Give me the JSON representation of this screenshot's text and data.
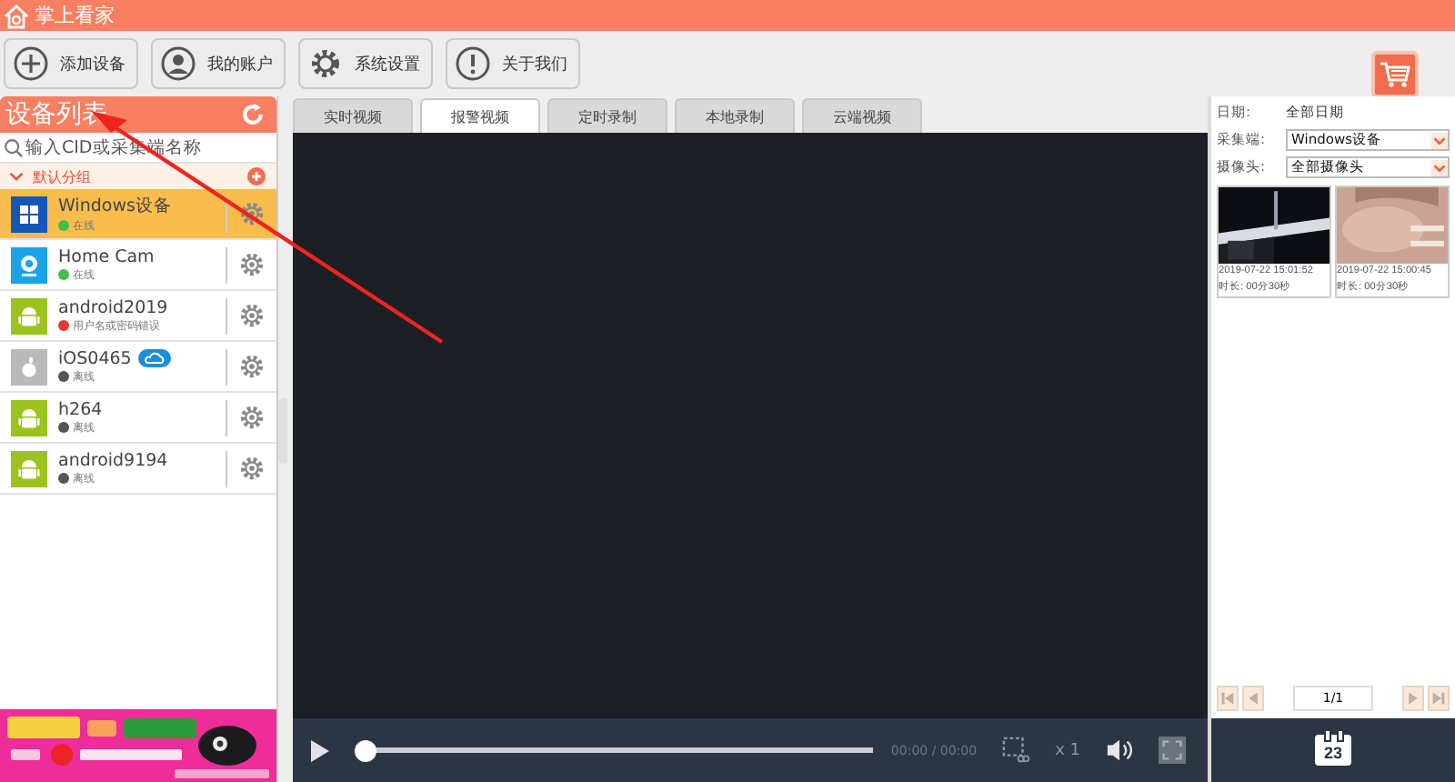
{
  "window": {
    "title": "掌上看家"
  },
  "toolbar": [
    {
      "label": "添加设备",
      "kind": "plus"
    },
    {
      "label": "我的账户",
      "kind": "user"
    },
    {
      "label": "系统设置",
      "kind": "gear"
    },
    {
      "label": "关于我们",
      "kind": "info"
    }
  ],
  "sidebar": {
    "title": "设备列表",
    "search": {
      "placeholder": "输入CID或采集端名称"
    },
    "group": {
      "label": "默认分组",
      "expanded": true
    },
    "devices": [
      {
        "name": "Windows设备",
        "kind": "windows",
        "status": "在线",
        "color": "#3cc04a",
        "selected": true,
        "cloud": false
      },
      {
        "name": "Home Cam",
        "kind": "camera",
        "status": "在线",
        "color": "#3cc04a",
        "selected": false,
        "cloud": false
      },
      {
        "name": "android2019",
        "kind": "android",
        "status": "用户名或密码错误",
        "color": "#e53935",
        "selected": false,
        "cloud": false
      },
      {
        "name": "iOS0465",
        "kind": "apple",
        "status": "离线",
        "color": "#555555",
        "selected": false,
        "cloud": true
      },
      {
        "name": "h264",
        "kind": "android",
        "status": "离线",
        "color": "#555555",
        "selected": false,
        "cloud": false
      },
      {
        "name": "android9194",
        "kind": "android",
        "status": "离线",
        "color": "#555555",
        "selected": false,
        "cloud": false
      }
    ]
  },
  "tabs": [
    {
      "label": "实时视频",
      "selected": false
    },
    {
      "label": "报警视频",
      "selected": true
    },
    {
      "label": "定时录制",
      "selected": false
    },
    {
      "label": "本地录制",
      "selected": false
    },
    {
      "label": "云端视频",
      "selected": false
    }
  ],
  "player": {
    "level": 0,
    "time": "00:00 / 00:00",
    "speed": "x 1"
  },
  "filters": {
    "date_label": "日期:",
    "date_value": "全部日期",
    "source_label": "采集端:",
    "source_value": "Windows设备",
    "camera_label": "摄像头:",
    "camera_value": "全部摄像头"
  },
  "clips": [
    {
      "time": "2019-07-22 15:01:52",
      "duration": "时长: 00分30秒",
      "kind": "dark"
    },
    {
      "time": "2019-07-22 15:00:45",
      "duration": "时长: 00分30秒",
      "kind": "skin"
    }
  ],
  "pager": {
    "page": "1/1"
  },
  "calendar": {
    "day": "23"
  }
}
